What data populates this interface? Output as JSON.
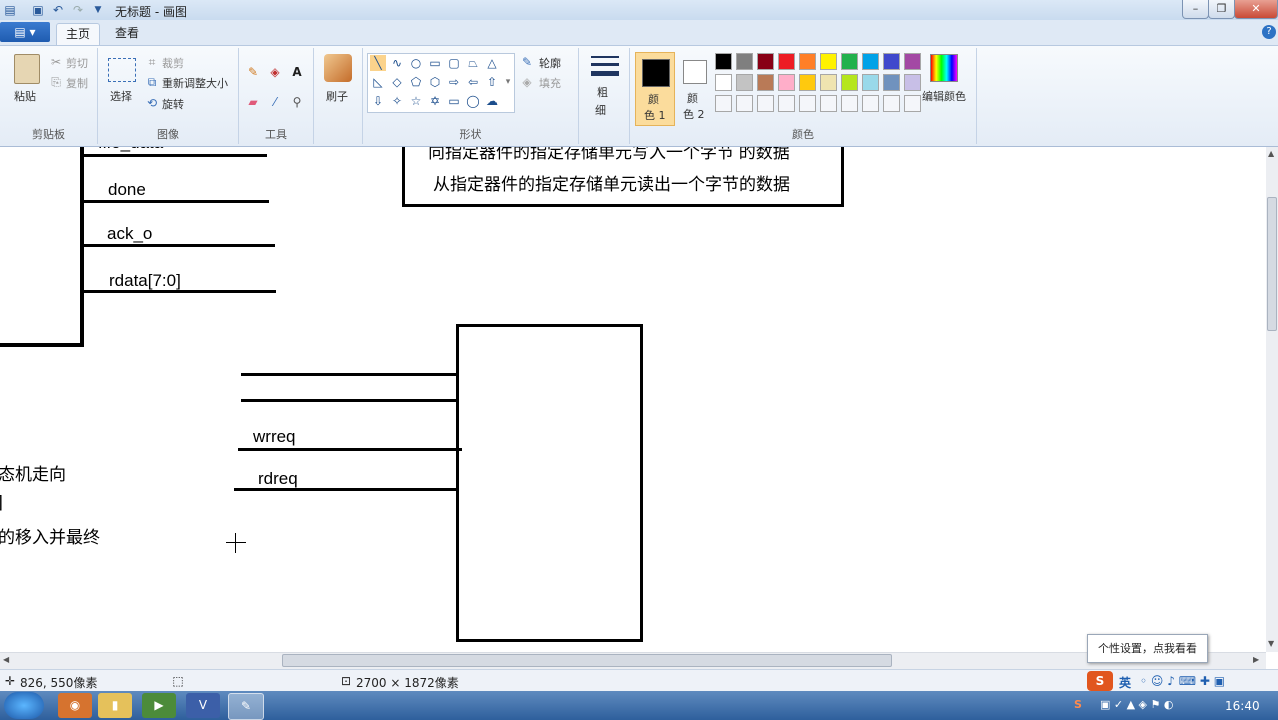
{
  "window": {
    "title": "无标题 - 画图",
    "min_icon": "minimize-icon",
    "max_icon": "maximize-icon",
    "close_icon": "close-icon"
  },
  "quick_access": {
    "save_icon": "save-icon",
    "undo_icon": "undo-icon",
    "redo_icon": "redo-icon",
    "dropdown_icon": "chevron-down-icon"
  },
  "ribbon_tabs": {
    "file_icon": "menu-icon",
    "home": "主页",
    "view": "查看",
    "help_icon": "help-icon"
  },
  "clipboard": {
    "paste": "粘贴",
    "cut": "剪切",
    "copy": "复制",
    "group": "剪贴板"
  },
  "image": {
    "select": "选择",
    "crop": "裁剪",
    "resize": "重新调整大小",
    "rotate": "旋转",
    "group": "图像"
  },
  "tools": {
    "group": "工具"
  },
  "brushes": {
    "label": "刷子"
  },
  "shapes": {
    "outline": "轮廓",
    "fill": "填充",
    "group": "形状"
  },
  "size": {
    "label1": "粗",
    "label2": "细"
  },
  "colors": {
    "color1_a": "颜",
    "color1_b": "色 1",
    "color2_a": "颜",
    "color2_b": "色 2",
    "edit": "编辑颜色",
    "group": "颜色",
    "color1": "#000000",
    "color2": "#ffffff",
    "palette_row1": [
      "#000000",
      "#7f7f7f",
      "#880015",
      "#ed1c24",
      "#ff7f27",
      "#fff200",
      "#22b14c",
      "#00a2e8",
      "#3f48cc",
      "#a349a4"
    ],
    "palette_row2": [
      "#ffffff",
      "#c3c3c3",
      "#b97a57",
      "#ffaec9",
      "#ffc90e",
      "#efe4b0",
      "#b5e61d",
      "#99d9ea",
      "#7092be",
      "#c8bfe7"
    ]
  },
  "canvas": {
    "signal_partial": "fifo_data",
    "done": "done",
    "ack": "ack_o",
    "rdata": "rdata[7:0]",
    "box_line1": "向指定器件的指定存储单元写入一个字节    的数据",
    "box_line2": "从指定器件的指定存储单元读出一个字节的数据",
    "wrreq": "wrreq",
    "rdreq": "rdreq",
    "left_text1": "态机走向",
    "left_text2": "]",
    "left_text3": "的移入并最终"
  },
  "status": {
    "cursor_pos": "826, 550像素",
    "canvas_size": "2700 × 1872像素",
    "tooltip": "个性设置，点我看看"
  },
  "taskbar": {
    "clock": "16:40",
    "ime_lang": "英"
  }
}
